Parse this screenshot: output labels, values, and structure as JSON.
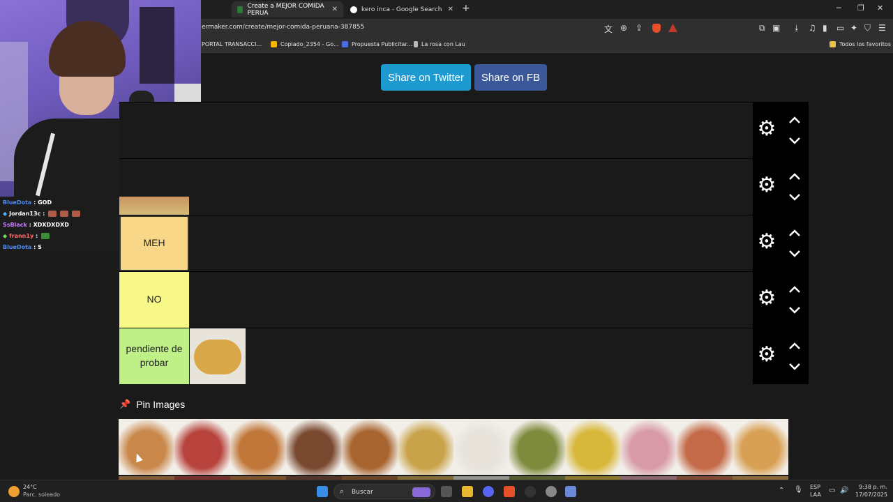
{
  "tabs": [
    {
      "title": "Create a MEJOR COMIDA PERUA",
      "active": true
    },
    {
      "title": "kero inca - Google Search",
      "active": false
    }
  ],
  "address": {
    "url": "ermaker.com/create/mejor-comida-peruana-387855"
  },
  "bookmarks": [
    "PORTAL TRANSACCI...",
    "Copiado_2354 - Go...",
    "Propuesta Publicitar...",
    "La rosa con Lau"
  ],
  "bookmarks_all": "Todos los favoritos",
  "chat": [
    {
      "user": "BlueDota",
      "color": "#4a8cff",
      "msg": "GOD",
      "emotes": 0
    },
    {
      "user": "Jordan13c",
      "color": "#ffffff",
      "msg": "",
      "emotes": 3
    },
    {
      "user": "SsBlack",
      "color": "#c77dff",
      "msg": "XDXDXDXD",
      "emotes": 0
    },
    {
      "user": "frann1y",
      "color": "#ff6b6b",
      "msg": "",
      "emotes": 1
    },
    {
      "user": "BlueDota",
      "color": "#4a8cff",
      "msg": "S",
      "emotes": 0
    }
  ],
  "share": {
    "twitter": "Share on Twitter",
    "fb": "Share on FB"
  },
  "tiers": [
    {
      "label": "",
      "color": "#1a1a1a"
    },
    {
      "label": "",
      "color": "#1a1a1a"
    },
    {
      "label": "MEH",
      "color": "#f8d888"
    },
    {
      "label": "NO",
      "color": "#f8f888"
    },
    {
      "label": "pendiente de probar",
      "color": "#bff088"
    }
  ],
  "pin_images": {
    "title": "Pin Images"
  },
  "pool_colors": [
    "#c9884a",
    "#b8423c",
    "#c2773a",
    "#7a4a30",
    "#a8642e",
    "#c9a34a",
    "#e8e4dc",
    "#7e8a3c",
    "#d8b83a",
    "#d89aa8",
    "#c46a48",
    "#d8a054"
  ],
  "taskbar": {
    "weather_temp": "24°C",
    "weather_desc": "Parc. soleado",
    "search_label": "Buscar",
    "lang_1": "ESP",
    "lang_2": "LAA",
    "time": "9:38 p. m.",
    "date": "17/07/2025"
  }
}
